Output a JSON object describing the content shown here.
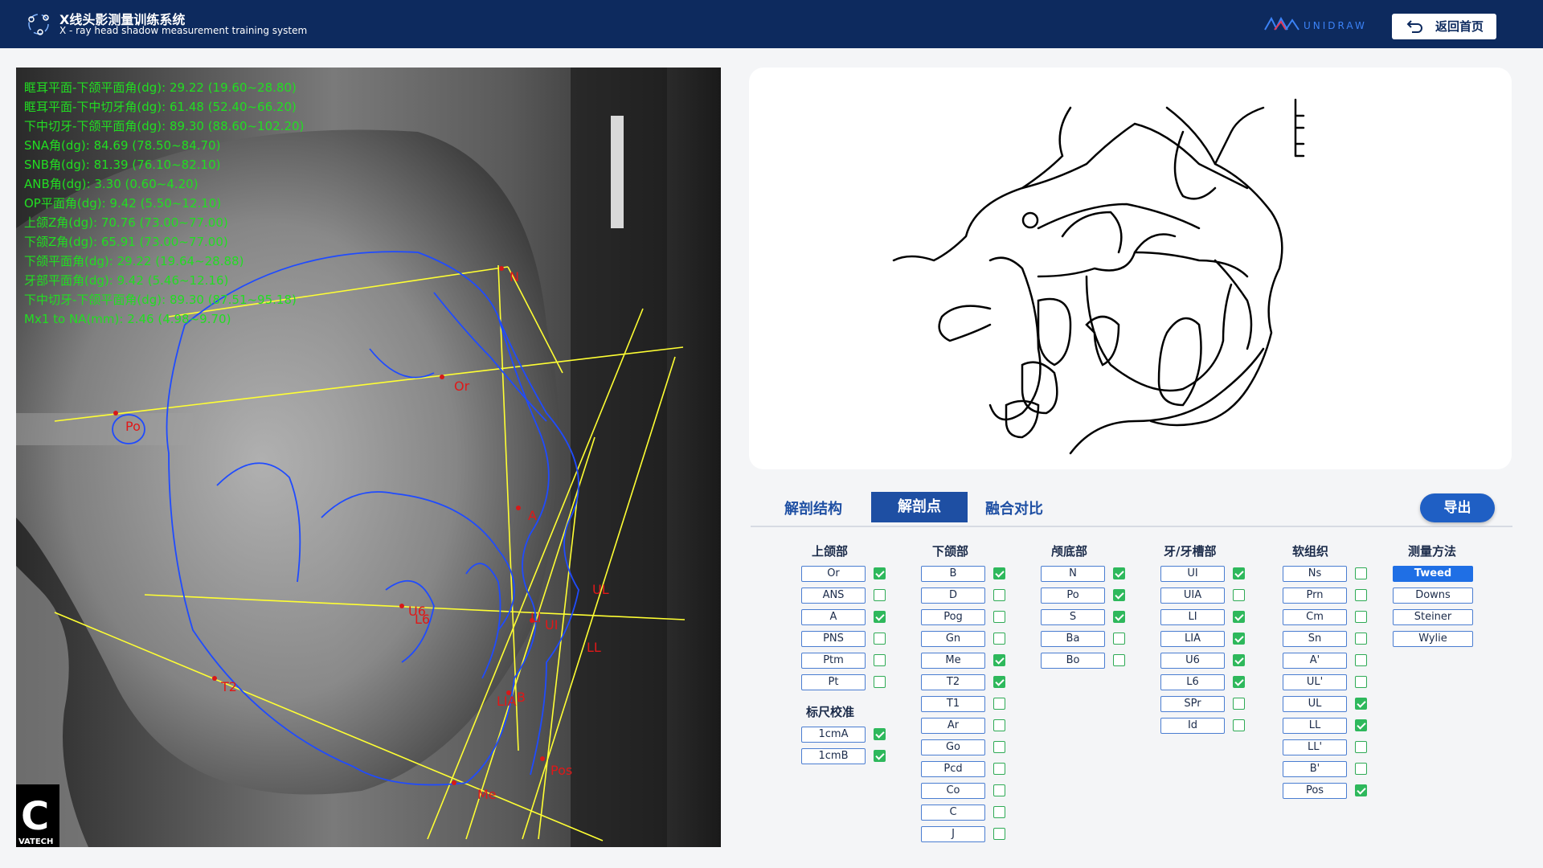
{
  "header": {
    "title_cn": "X线头影测量训练系统",
    "title_en": "X - ray head shadow measurement training system",
    "brand": "UNIDRAW",
    "home_button": "返回首页"
  },
  "xray": {
    "overlay_lines": [
      "眶耳平面-下颌平面角(dg): 29.22    (19.60~28.80)",
      "眶耳平面-下中切牙角(dg): 61.48    (52.40~66.20)",
      "下中切牙-下颌平面角(dg): 89.30    (88.60~102.20)",
      "SNA角(dg): 84.69    (78.50~84.70)",
      "SNB角(dg): 81.39    (76.10~82.10)",
      "ANB角(dg): 3.30      (0.60~4.20)",
      "OP平面角(dg): 9.42      (5.50~12.10)",
      "上颌Z角(dg): 70.76    (73.00~77.00)",
      "下颌Z角(dg): 65.91    (73.00~77.00)",
      "下颌平面角(dg): 29.22    (19.64~28.88)",
      "牙部平面角(dg): 9.42      (5.46~12.16)",
      "下中切牙-下颌平面角(dg): 89.30    (87.51~95.18)",
      "Mx1 to NA(mm): 2.46      (4.98~9.70)"
    ],
    "landmark_labels": [
      "N",
      "Or",
      "Po",
      "A",
      "UL",
      "LL",
      "UI",
      "Li",
      "U6",
      "L6",
      "LIA",
      "B",
      "Pos",
      "Me",
      "T2"
    ],
    "vendor_logo": "C",
    "vendor_name": "VATECH"
  },
  "tabs": [
    {
      "label": "解剖结构",
      "active": false
    },
    {
      "label": "解剖点",
      "active": true
    },
    {
      "label": "融合对比",
      "active": false
    }
  ],
  "export_button": "导出",
  "columns": {
    "maxilla": {
      "title": "上颌部",
      "items": [
        {
          "label": "Or",
          "checked": true
        },
        {
          "label": "ANS",
          "checked": false
        },
        {
          "label": "A",
          "checked": true
        },
        {
          "label": "PNS",
          "checked": false
        },
        {
          "label": "Ptm",
          "checked": false
        },
        {
          "label": "Pt",
          "checked": false
        }
      ]
    },
    "ruler": {
      "title": "标尺校准",
      "items": [
        {
          "label": "1cmA",
          "checked": true
        },
        {
          "label": "1cmB",
          "checked": true
        }
      ]
    },
    "mandible": {
      "title": "下颌部",
      "items": [
        {
          "label": "B",
          "checked": true
        },
        {
          "label": "D",
          "checked": false
        },
        {
          "label": "Pog",
          "checked": false
        },
        {
          "label": "Gn",
          "checked": false
        },
        {
          "label": "Me",
          "checked": true
        },
        {
          "label": "T2",
          "checked": true
        },
        {
          "label": "T1",
          "checked": false
        },
        {
          "label": "Ar",
          "checked": false
        },
        {
          "label": "Go",
          "checked": false
        },
        {
          "label": "Pcd",
          "checked": false
        },
        {
          "label": "Co",
          "checked": false
        },
        {
          "label": "C",
          "checked": false
        },
        {
          "label": "J",
          "checked": false
        }
      ]
    },
    "cranial_base": {
      "title": "颅底部",
      "items": [
        {
          "label": "N",
          "checked": true
        },
        {
          "label": "Po",
          "checked": true
        },
        {
          "label": "S",
          "checked": true
        },
        {
          "label": "Ba",
          "checked": false
        },
        {
          "label": "Bo",
          "checked": false
        }
      ]
    },
    "teeth": {
      "title": "牙/牙槽部",
      "items": [
        {
          "label": "UI",
          "checked": true
        },
        {
          "label": "UIA",
          "checked": false
        },
        {
          "label": "LI",
          "checked": true
        },
        {
          "label": "LIA",
          "checked": true
        },
        {
          "label": "U6",
          "checked": true
        },
        {
          "label": "L6",
          "checked": true
        },
        {
          "label": "SPr",
          "checked": false
        },
        {
          "label": "Id",
          "checked": false
        }
      ]
    },
    "soft_tissue": {
      "title": "软组织",
      "items": [
        {
          "label": "Ns",
          "checked": false
        },
        {
          "label": "Prn",
          "checked": false
        },
        {
          "label": "Cm",
          "checked": false
        },
        {
          "label": "Sn",
          "checked": false
        },
        {
          "label": "A'",
          "checked": false
        },
        {
          "label": "UL'",
          "checked": false
        },
        {
          "label": "UL",
          "checked": true
        },
        {
          "label": "LL",
          "checked": true
        },
        {
          "label": "LL'",
          "checked": false
        },
        {
          "label": "B'",
          "checked": false
        },
        {
          "label": "Pos",
          "checked": true
        }
      ]
    },
    "methods": {
      "title": "测量方法",
      "items": [
        {
          "label": "Tweed",
          "selected": true
        },
        {
          "label": "Downs",
          "selected": false
        },
        {
          "label": "Steiner",
          "selected": false
        },
        {
          "label": "Wylie",
          "selected": false
        }
      ]
    }
  }
}
